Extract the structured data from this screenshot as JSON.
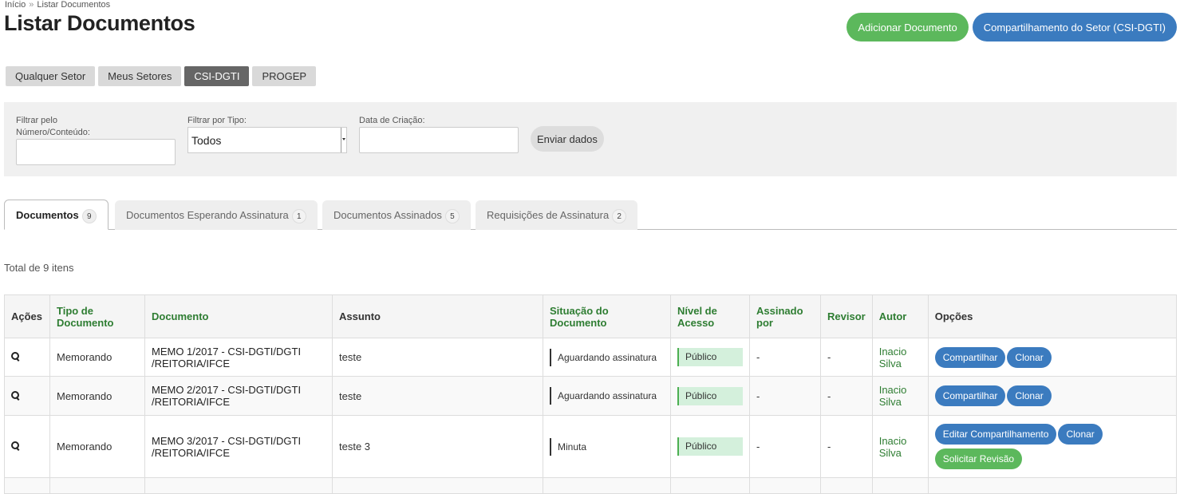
{
  "breadcrumb": {
    "home": "Início",
    "separator": "»",
    "current": "Listar Documentos"
  },
  "page": {
    "title": "Listar Documentos"
  },
  "actions": {
    "add_document": "Adicionar Documento",
    "sector_share": "Compartilhamento do Setor (CSI-DGTI)"
  },
  "sector_tabs": [
    "Qualquer Setor",
    "Meus Setores",
    "CSI-DGTI",
    "PROGEP"
  ],
  "filters": {
    "number_label": "Filtrar pelo Número/Conteúdo:",
    "type_label": "Filtrar por Tipo:",
    "type_value": "Todos",
    "date_label": "Data de Criação:",
    "submit": "Enviar dados"
  },
  "doc_tabs": [
    {
      "label": "Documentos",
      "count": "9"
    },
    {
      "label": "Documentos Esperando Assinatura",
      "count": "1"
    },
    {
      "label": "Documentos Assinados",
      "count": "5"
    },
    {
      "label": "Requisições de Assinatura",
      "count": "2"
    }
  ],
  "total_text": "Total de 9 itens",
  "table": {
    "headers": {
      "acoes": "Ações",
      "tipo": "Tipo de Documento",
      "documento": "Documento",
      "assunto": "Assunto",
      "situacao": "Situação do Documento",
      "nivel": "Nível de Acesso",
      "assinado": "Assinado por",
      "revisor": "Revisor",
      "autor": "Autor",
      "opcoes": "Opções"
    },
    "rows": [
      {
        "tipo": "Memorando",
        "documento": "MEMO 1/2017 - CSI-DGTI/DGTI /REITORIA/IFCE",
        "assunto": "teste",
        "situacao": "Aguardando assinatura",
        "nivel": "Público",
        "assinado": "-",
        "revisor": "-",
        "autor": "Inacio Silva",
        "btn1": "Compartilhar",
        "btn2": "Clonar"
      },
      {
        "tipo": "Memorando",
        "documento": "MEMO 2/2017 - CSI-DGTI/DGTI /REITORIA/IFCE",
        "assunto": "teste",
        "situacao": "Aguardando assinatura",
        "nivel": "Público",
        "assinado": "-",
        "revisor": "-",
        "autor": "Inacio Silva",
        "btn1": "Compartilhar",
        "btn2": "Clonar"
      },
      {
        "tipo": "Memorando",
        "documento": "MEMO 3/2017 - CSI-DGTI/DGTI /REITORIA/IFCE",
        "assunto": "teste 3",
        "situacao": "Minuta",
        "nivel": "Público",
        "assinado": "-",
        "revisor": "-",
        "autor": "Inacio Silva",
        "btn1": "Editar Compartilhamento",
        "btn2": "Clonar",
        "btn3": "Solicitar Revisão"
      }
    ]
  },
  "colors": {
    "green": "#5cb85c",
    "blue": "#3b7bbf",
    "header_green": "#2e7d32"
  }
}
